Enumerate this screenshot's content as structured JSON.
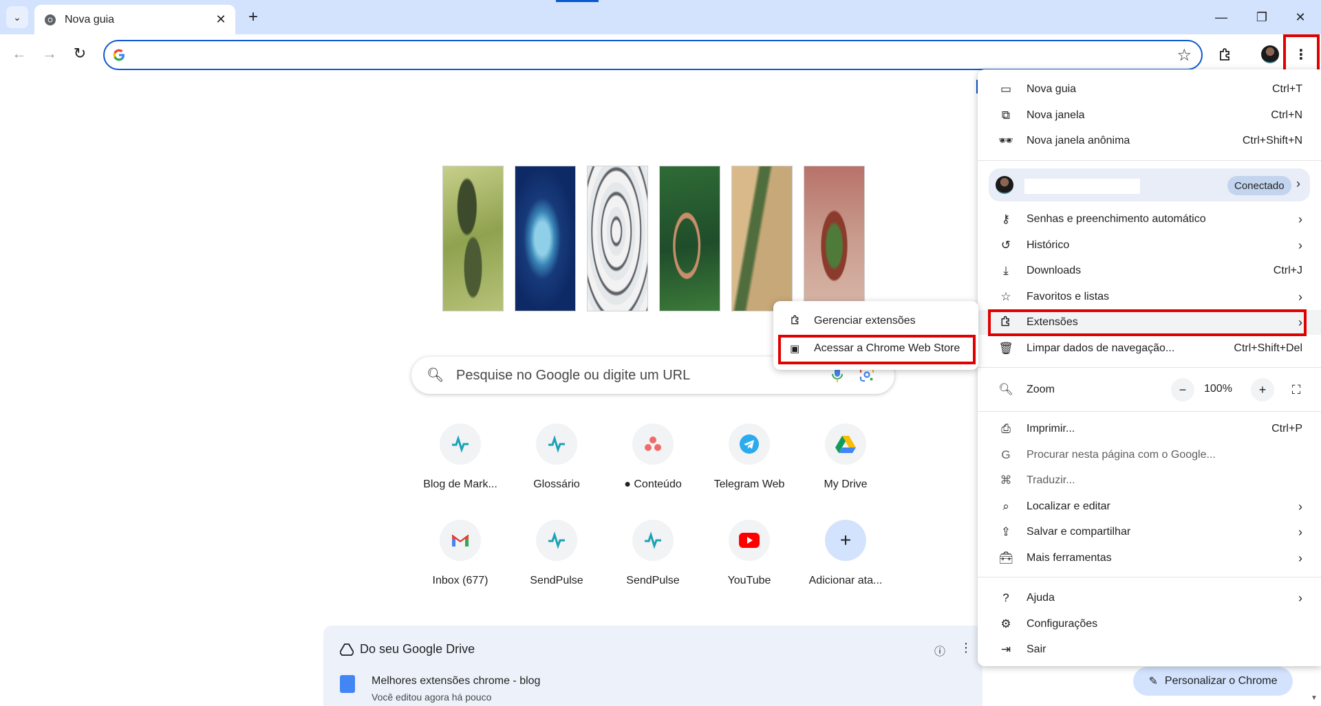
{
  "tab": {
    "title": "Nova guia"
  },
  "window_controls": {
    "minimize": "—",
    "restore": "❐",
    "close": "✕"
  },
  "ntp": {
    "search_placeholder": "Pesquise no Google ou digite um URL",
    "shortcuts": [
      {
        "label": "Blog de Mark...",
        "icon": "sendpulse-icon"
      },
      {
        "label": "Glossário",
        "icon": "sendpulse-icon"
      },
      {
        "label": "● Conteúdo",
        "icon": "asana-icon"
      },
      {
        "label": "Telegram Web",
        "icon": "telegram-icon"
      },
      {
        "label": "My Drive",
        "icon": "drive-icon"
      },
      {
        "label": "Inbox (677)",
        "icon": "gmail-icon"
      },
      {
        "label": "SendPulse",
        "icon": "sendpulse-icon"
      },
      {
        "label": "SendPulse",
        "icon": "sendpulse-icon"
      },
      {
        "label": "YouTube",
        "icon": "youtube-icon"
      },
      {
        "label": "Adicionar ata...",
        "icon": "plus-icon"
      }
    ],
    "drive_card": {
      "title": "Do seu Google Drive",
      "doc_name": "Melhores extensões chrome - blog",
      "doc_meta": "Você editou agora há pouco"
    },
    "customize_label": "Personalizar o Chrome"
  },
  "menu": {
    "items_top": [
      {
        "label": "Nova guia",
        "shortcut": "Ctrl+T",
        "icon": "new-tab-icon"
      },
      {
        "label": "Nova janela",
        "shortcut": "Ctrl+N",
        "icon": "new-window-icon"
      },
      {
        "label": "Nova janela anônima",
        "shortcut": "Ctrl+Shift+N",
        "icon": "incognito-icon"
      }
    ],
    "profile": {
      "status": "Conectado"
    },
    "items_mid": [
      {
        "label": "Senhas e preenchimento automático",
        "icon": "key-icon"
      },
      {
        "label": "Histórico",
        "icon": "history-icon"
      },
      {
        "label": "Downloads",
        "shortcut": "Ctrl+J",
        "icon": "download-icon"
      },
      {
        "label": "Favoritos e listas",
        "icon": "star-icon"
      },
      {
        "label": "Extensões",
        "icon": "extensions-icon"
      },
      {
        "label": "Limpar dados de navegação...",
        "shortcut": "Ctrl+Shift+Del",
        "icon": "trash-icon"
      }
    ],
    "zoom": {
      "label": "Zoom",
      "value": "100%",
      "minus": "−",
      "plus": "+"
    },
    "items_tools": [
      {
        "label": "Imprimir...",
        "shortcut": "Ctrl+P",
        "icon": "print-icon"
      },
      {
        "label": "Procurar nesta página com o Google...",
        "icon": "google-icon"
      },
      {
        "label": "Traduzir...",
        "icon": "translate-icon"
      },
      {
        "label": "Localizar e editar",
        "icon": "find-icon"
      },
      {
        "label": "Salvar e compartilhar",
        "icon": "save-share-icon"
      },
      {
        "label": "Mais ferramentas",
        "icon": "toolbox-icon"
      }
    ],
    "items_bottom": [
      {
        "label": "Ajuda",
        "icon": "help-icon"
      },
      {
        "label": "Configurações",
        "icon": "settings-icon"
      },
      {
        "label": "Sair",
        "icon": "exit-icon"
      }
    ]
  },
  "submenu": {
    "items": [
      {
        "label": "Gerenciar extensões",
        "icon": "extensions-icon"
      },
      {
        "label": "Acessar a Chrome Web Store",
        "icon": "web-store-icon"
      }
    ]
  },
  "colors": {
    "accent": "#0b57d0",
    "highlight": "#e00000",
    "tabstrip": "#d3e3fd"
  }
}
